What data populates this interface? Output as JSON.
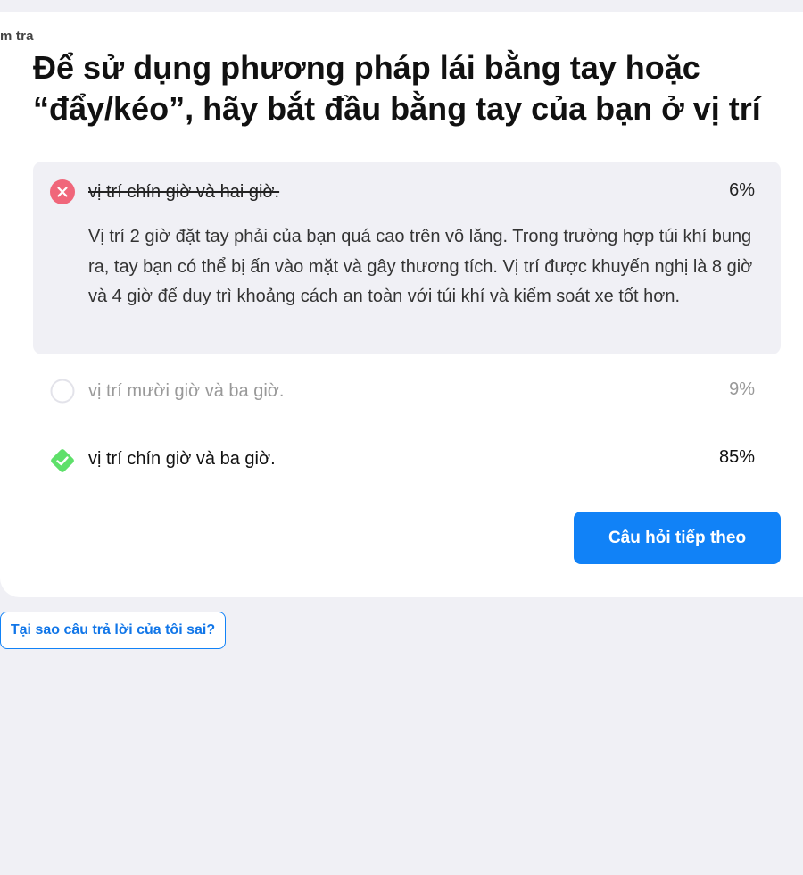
{
  "breadcrumb": "m tra",
  "question": "Để sử dụng phương pháp lái bằng tay hoặc “đẩy/kéo”, hãy bắt đầu bằng tay của bạn ở vị trí",
  "options": [
    {
      "label": "vị trí chín giờ và hai giờ.",
      "percent": "6%",
      "state": "wrong",
      "icon": "x-circle-icon",
      "explanation": "Vị trí 2 giờ đặt tay phải của bạn quá cao trên vô lăng. Trong trường hợp túi khí bung ra, tay bạn có thể bị ấn vào mặt và gây thương tích. Vị trí được khuyến nghị là 8 giờ và 4 giờ để duy trì khoảng cách an toàn với túi khí và kiểm soát xe tốt hơn."
    },
    {
      "label": "vị trí mười giờ và ba giờ.",
      "percent": "9%",
      "state": "neutral",
      "icon": "empty-circle-icon"
    },
    {
      "label": "vị trí chín giờ và ba giờ.",
      "percent": "85%",
      "state": "correct",
      "icon": "check-diamond-icon"
    }
  ],
  "buttons": {
    "next_label": "Câu hỏi tiếp theo",
    "why_label": "Tại sao câu trả lời của tôi sai?"
  },
  "colors": {
    "wrong": "#f0667a",
    "correct": "#5ee06a",
    "primary": "#1182f7",
    "panel": "#f0f0f5"
  }
}
